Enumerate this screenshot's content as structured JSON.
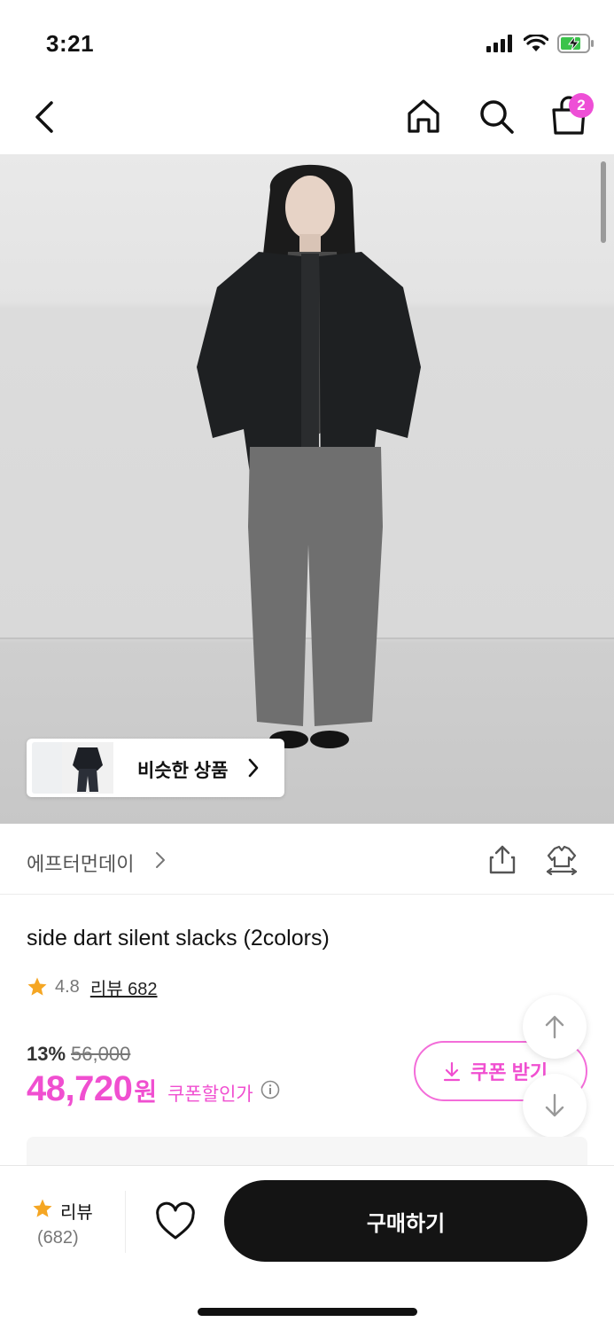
{
  "status_bar": {
    "time": "3:21"
  },
  "nav": {
    "cart_count": "2"
  },
  "product_image": {
    "similar_products_label": "비슷한 상품"
  },
  "brand": {
    "name": "에프터먼데이"
  },
  "product": {
    "title": "side dart silent slacks (2colors)",
    "rating": "4.8",
    "review_link": "리뷰 682",
    "discount_rate": "13%",
    "original_price": "56,000",
    "sale_price": "48,720",
    "currency": "원",
    "coupon_discount_label": "쿠폰할인가"
  },
  "coupon": {
    "button_label": "쿠폰 받기"
  },
  "bottom_bar": {
    "review_label": "리뷰",
    "review_count": "(682)",
    "buy_label": "구매하기"
  },
  "colors": {
    "accent": "#f04fd0",
    "badge": "#ee4fd6",
    "star": "#f5a623",
    "buy_button": "#141414"
  }
}
